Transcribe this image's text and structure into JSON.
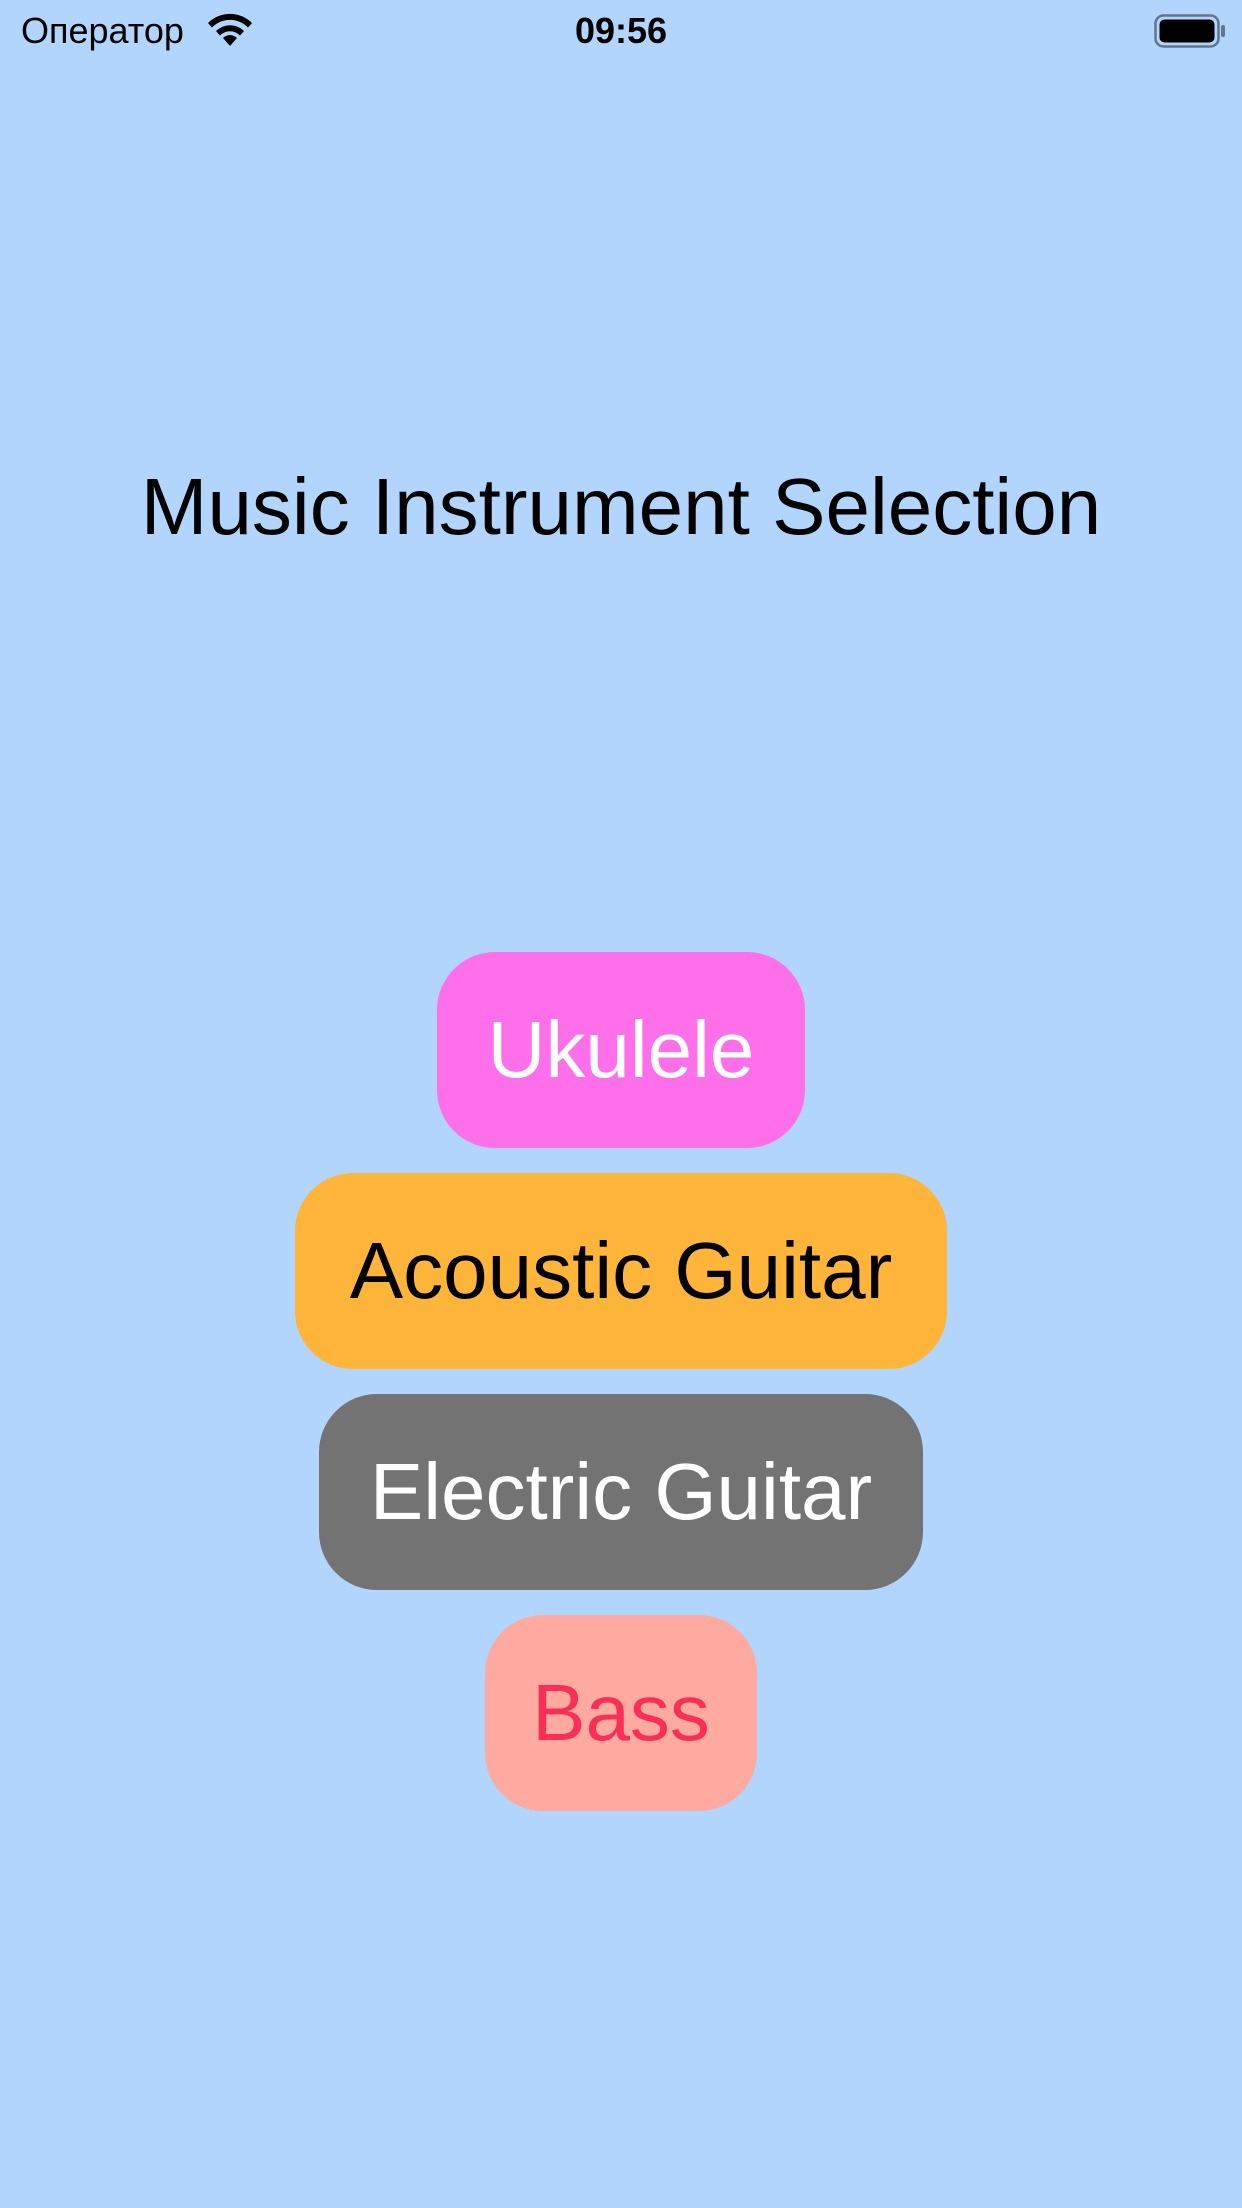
{
  "status_bar": {
    "carrier": "Оператор",
    "time": "09:56",
    "wifi_icon": "wifi-icon",
    "battery_icon": "battery-full-icon"
  },
  "title": "Music Instrument Selection",
  "instruments": [
    {
      "label": "Ukulele",
      "background": "#FF6FE9",
      "text_color": "#FFFFFF"
    },
    {
      "label": "Acoustic Guitar",
      "background": "#FFB43A",
      "text_color": "#000000"
    },
    {
      "label": "Electric Guitar",
      "background": "#737373",
      "text_color": "#FFFFFF"
    },
    {
      "label": "Bass",
      "background": "#FFAAA0",
      "text_color": "#FB2E55"
    }
  ],
  "colors": {
    "page_background": "#B1D5FD"
  }
}
